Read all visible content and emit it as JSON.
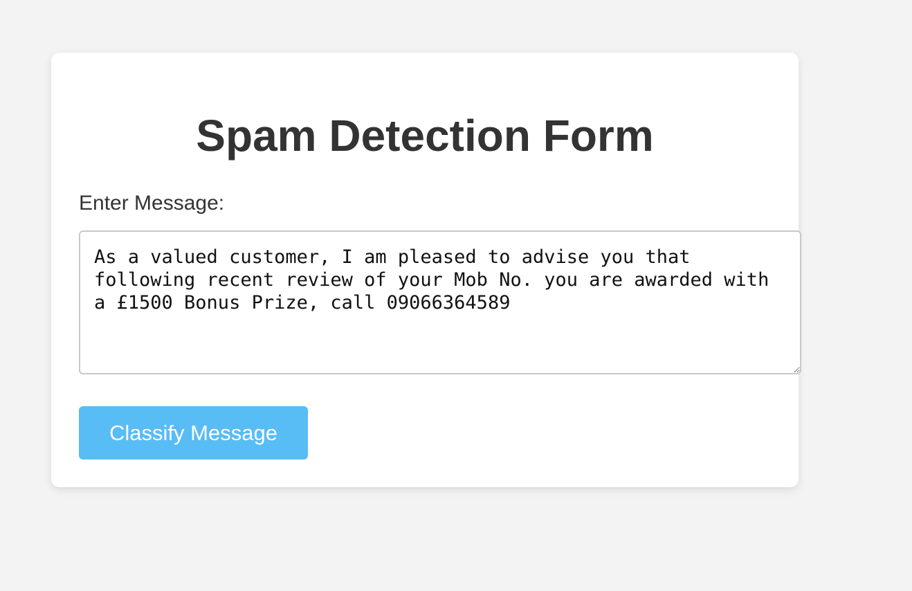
{
  "form": {
    "title": "Spam Detection Form",
    "message_label": "Enter Message:",
    "message_value": "As a valued customer, I am pleased to advise you that following recent review of your Mob No. you are awarded with a £1500 Bonus Prize, call 09066364589",
    "submit_label": "Classify Message"
  },
  "colors": {
    "page_background": "#f3f3f3",
    "card_background": "#ffffff",
    "button_background": "#58bcf5",
    "button_text": "#ffffff",
    "heading_text": "#333333"
  }
}
